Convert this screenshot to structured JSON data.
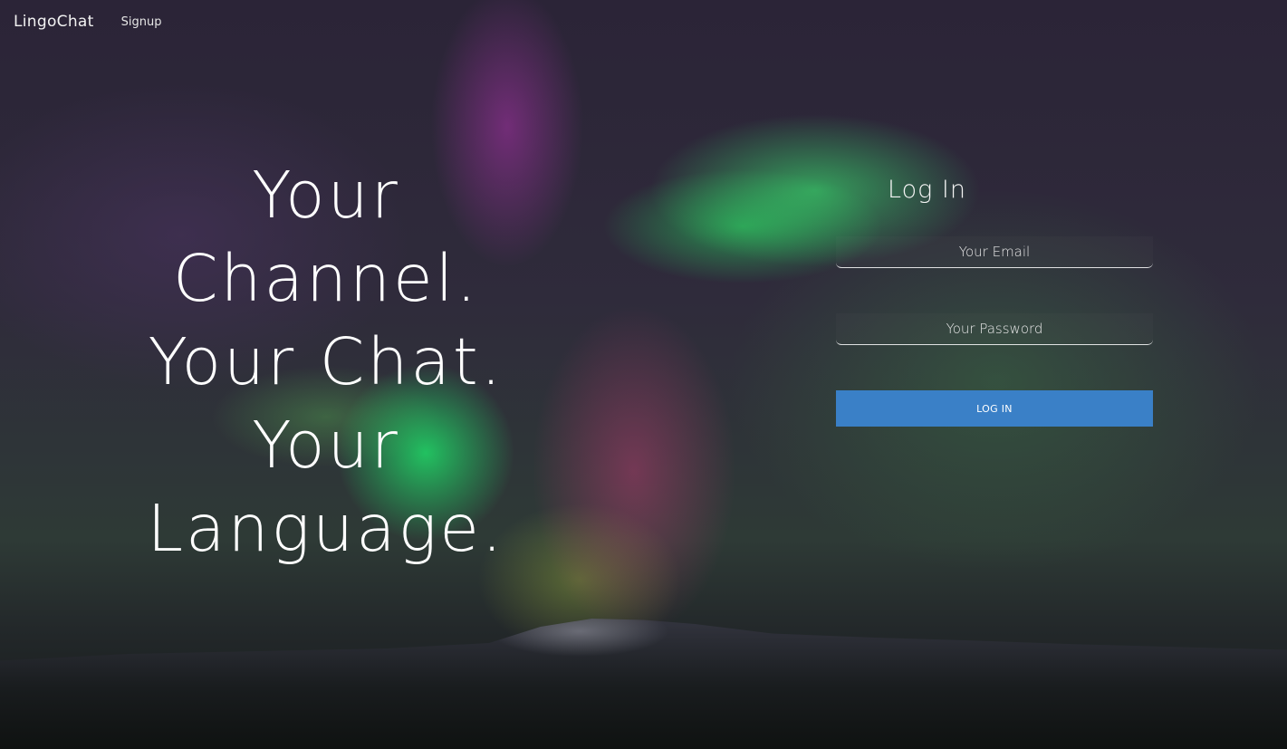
{
  "nav": {
    "brand": "LingoChat",
    "signup_label": "Signup"
  },
  "hero": {
    "lines": [
      "Your",
      "Channel.",
      "Your Chat.",
      "Your",
      "Language."
    ]
  },
  "login": {
    "title": "Log In",
    "email_placeholder": "Your Email",
    "email_value": "",
    "password_placeholder": "Your Password",
    "password_value": "",
    "button_label": "LOG IN"
  },
  "colors": {
    "button": "#3a80c7",
    "text": "#ffffff"
  }
}
